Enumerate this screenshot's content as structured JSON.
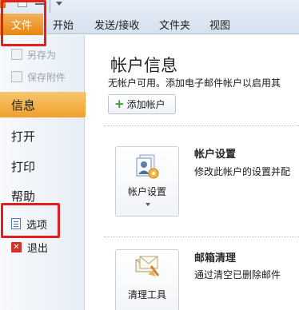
{
  "ribbon": {
    "file_tab": "文件",
    "tabs": [
      "开始",
      "发送/接收",
      "文件夹",
      "视图"
    ]
  },
  "nav": {
    "save_as": "另存为",
    "save_attachments": "保存附件",
    "info": "信息",
    "open": "打开",
    "print": "打印",
    "help": "帮助",
    "options": "选项",
    "exit": "退出"
  },
  "main": {
    "title": "帐户信息",
    "subtitle": "无帐户可用。添加电子邮件帐户以启用其",
    "add_account_button": "添加帐户",
    "account_settings": {
      "tile_label": "帐户设置",
      "heading": "帐户设置",
      "description": "修改此帐户的设置并配"
    },
    "mailbox_cleanup": {
      "tile_label": "清理工具",
      "heading": "邮箱清理",
      "description": "通过清空已删除邮件"
    }
  },
  "colors": {
    "file_tab": "#e8860f",
    "active_nav": "#f0a02c",
    "highlight_box": "#e0201c",
    "ribbon_bg": "#dce6f2"
  }
}
